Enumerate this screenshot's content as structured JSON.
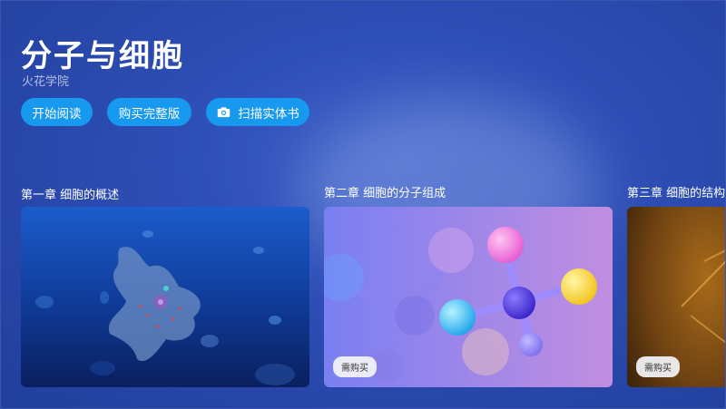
{
  "book": {
    "title": "分子与细胞",
    "publisher": "火花学院"
  },
  "actions": {
    "start_reading": "开始阅读",
    "buy_full": "购买完整版",
    "scan_book": "扫描实体书",
    "scan_icon": "camera-icon"
  },
  "chapters": [
    {
      "title": "第一章 细胞的概述",
      "badge": ""
    },
    {
      "title": "第二章 细胞的分子组成",
      "badge": "需购买"
    },
    {
      "title": "第三章 细胞的结构",
      "badge": "需购买"
    }
  ],
  "colors": {
    "background": "#2a49ac",
    "button": "#1699ee",
    "card1_top": "#1a56c4",
    "card2_left": "#7a7ff2",
    "card2_right": "#c18ee0",
    "card3": "#7a4a12"
  }
}
